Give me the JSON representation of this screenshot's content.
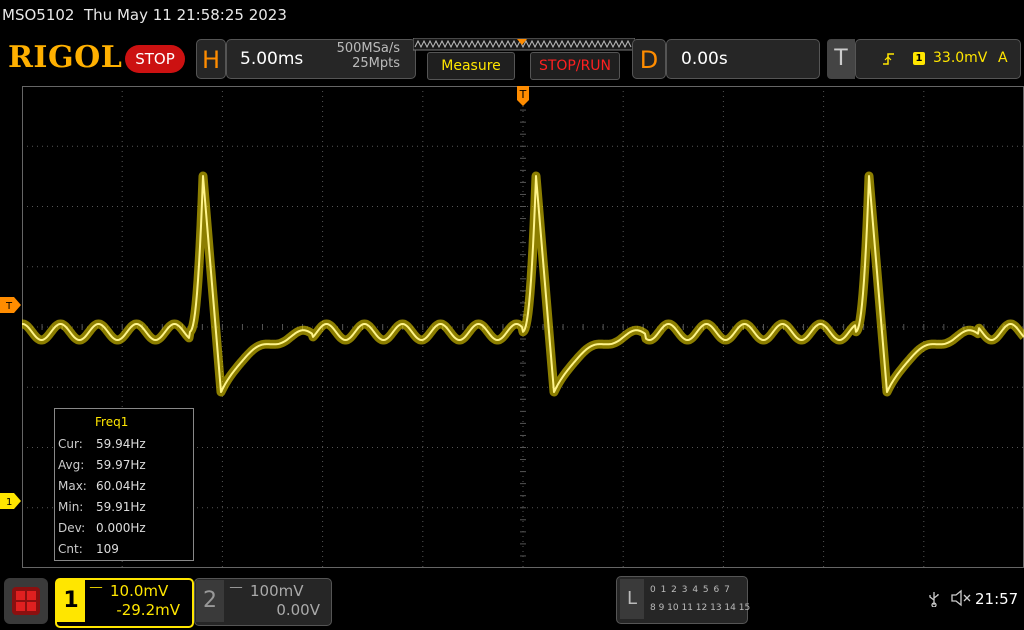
{
  "header": {
    "model": "MSO5102",
    "datetime": "Thu May 11 21:58:25 2023",
    "logo": "RIGOL",
    "run_state": "STOP"
  },
  "horizontal": {
    "letter": "H",
    "timebase": "5.00ms",
    "sample_rate": "500MSa/s",
    "memory_depth": "25Mpts"
  },
  "buttons": {
    "measure": "Measure",
    "stop_run": "STOP/RUN"
  },
  "delay": {
    "letter": "D",
    "value": "0.00s"
  },
  "trigger": {
    "letter": "T",
    "edge_icon": "rising-edge-icon",
    "source": "1",
    "level": "33.0mV",
    "mode": "A",
    "marker": "T"
  },
  "measurement": {
    "title": "Freq1",
    "rows": [
      {
        "label": "Cur:",
        "value": "59.94Hz"
      },
      {
        "label": "Avg:",
        "value": "59.97Hz"
      },
      {
        "label": "Max:",
        "value": "60.04Hz"
      },
      {
        "label": "Min:",
        "value": "59.91Hz"
      },
      {
        "label": "Dev:",
        "value": "0.000Hz"
      },
      {
        "label": "Cnt:",
        "value": "109"
      }
    ]
  },
  "channel1": {
    "number": "1",
    "scale": "10.0mV",
    "offset": "-29.2mV",
    "color": "#ffe600",
    "marker": "1"
  },
  "channel2": {
    "number": "2",
    "scale": "100mV",
    "offset": "0.00V"
  },
  "logic": {
    "letter": "L",
    "row1": "0 1 2 3   4 5 6 7",
    "row2": "8 9 10 11 12 13 14 15"
  },
  "status": {
    "clock": "21:57"
  },
  "colors": {
    "accent": "#ff8c00",
    "trace": "#ffe600",
    "stop": "#cc1111"
  }
}
